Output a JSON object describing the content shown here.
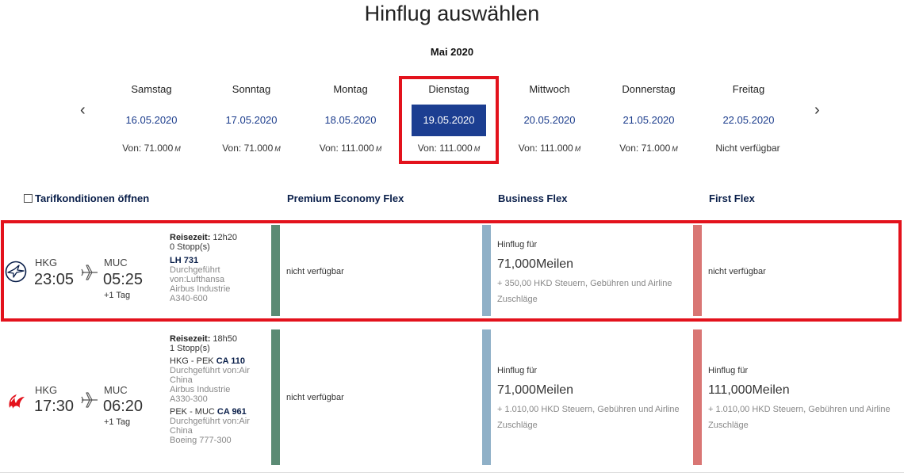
{
  "page": {
    "title": "Hinflug auswählen",
    "month": "Mai 2020"
  },
  "nav": {
    "prev": "‹",
    "next": "›"
  },
  "days": [
    {
      "name": "Samstag",
      "date": "16.05.2020",
      "price": "Von: 71.000",
      "unit": "M"
    },
    {
      "name": "Sonntag",
      "date": "17.05.2020",
      "price": "Von: 71.000",
      "unit": "M"
    },
    {
      "name": "Montag",
      "date": "18.05.2020",
      "price": "Von: 111.000",
      "unit": "M"
    },
    {
      "name": "Dienstag",
      "date": "19.05.2020",
      "price": "Von: 111.000",
      "unit": "M",
      "selected": true
    },
    {
      "name": "Mittwoch",
      "date": "20.05.2020",
      "price": "Von: 111.000",
      "unit": "M"
    },
    {
      "name": "Donnerstag",
      "date": "21.05.2020",
      "price": "Von: 71.000",
      "unit": "M"
    },
    {
      "name": "Freitag",
      "date": "22.05.2020",
      "price": "Nicht verfügbar",
      "unit": ""
    }
  ],
  "headers": {
    "tarif": "Tarifkonditionen öffnen",
    "premium": "Premium Economy Flex",
    "business": "Business Flex",
    "first": "First Flex"
  },
  "flights": [
    {
      "airline_icon": "lufthansa-crane-icon",
      "from": "HKG",
      "dep": "23:05",
      "to": "MUC",
      "arr": "05:25",
      "plus": "+1 Tag",
      "travel_label": "Reisezeit:",
      "travel_time": "12h20",
      "stops": "0 Stopp(s)",
      "legs": [
        {
          "route": "",
          "flight": "LH 731",
          "operated": "Durchgeführt von:Lufthansa",
          "aircraft": "Airbus Industrie A340-600"
        }
      ],
      "premium": "nicht verfügbar",
      "business": {
        "label": "Hinflug für",
        "miles": "71,000Meilen",
        "tax": "+ 350,00 HKD Steuern, Gebühren und Airline Zuschläge"
      },
      "first": "nicht verfügbar"
    },
    {
      "airline_icon": "air-china-phoenix-icon",
      "from": "HKG",
      "dep": "17:30",
      "to": "MUC",
      "arr": "06:20",
      "plus": "+1 Tag",
      "travel_label": "Reisezeit:",
      "travel_time": "18h50",
      "stops": "1 Stopp(s)",
      "legs": [
        {
          "route": "HKG - PEK",
          "flight": "CA 110",
          "operated": "Durchgeführt von:Air China",
          "aircraft": "Airbus Industrie A330-300"
        },
        {
          "route": "PEK - MUC",
          "flight": "CA 961",
          "operated": "Durchgeführt von:Air China",
          "aircraft": "Boeing 777-300"
        }
      ],
      "premium": "nicht verfügbar",
      "business": {
        "label": "Hinflug für",
        "miles": "71,000Meilen",
        "tax": "+ 1.010,00 HKD Steuern, Gebühren und Airline Zuschläge"
      },
      "first": {
        "label": "Hinflug für",
        "miles": "111,000Meilen",
        "tax": "+ 1.010,00 HKD Steuern, Gebühren und Airline Zuschläge"
      }
    }
  ],
  "colors": {
    "selected_border": "#e3121c",
    "selected_date_bg": "#1c3e91",
    "date_link": "#1b3c8c",
    "premium_bar": "#5b8b74",
    "business_bar": "#8fb0c7",
    "first_bar": "#d97674"
  }
}
